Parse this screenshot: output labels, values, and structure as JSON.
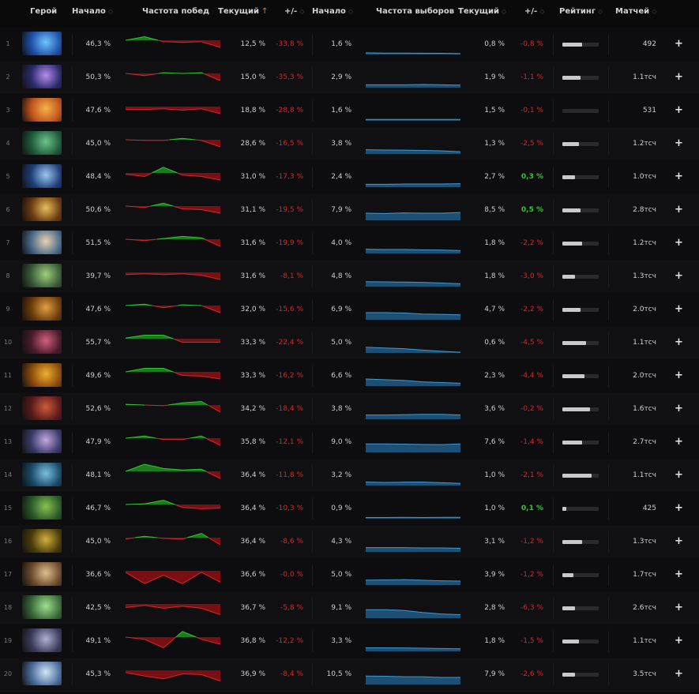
{
  "header": {
    "hero": "Герой",
    "wr_start": "Начало",
    "wr_chart": "Частота побед",
    "wr_current": "Текущий",
    "wr_diff": "+/-",
    "pr_start": "Начало",
    "pr_chart": "Частота выборов",
    "pr_current": "Текущий",
    "pr_diff": "+/-",
    "rating": "Рейтинг",
    "matches": "Матчей"
  },
  "colors": {
    "positive": "#2ec82e",
    "negative": "#d6262b",
    "win_up_fill": "#1d7a1d",
    "win_down_fill": "#7a0f13",
    "pick_line": "#3a9ad9",
    "sort_active": "#e07d2a"
  },
  "rows": [
    {
      "index": "1",
      "hero_icon": "hero-portrait",
      "wr_start": "46,3 %",
      "wr_cur": "12,5 %",
      "wr_diff": "-33,8 %",
      "wr_diff_sign": "neg",
      "pr_start": "1,6 %",
      "pr_cur": "0,8 %",
      "pr_diff": "-0,8 %",
      "pr_diff_sign": "neg",
      "rating": 0.55,
      "matches": "492",
      "wr_trend": [
        0,
        0.5,
        -0.2,
        -0.3,
        -0.2,
        -1
      ],
      "pr_trend": [
        0.12,
        0.1,
        0.1,
        0.09,
        0.08,
        0.06
      ],
      "colors": [
        "#1f4fa8",
        "#6fc3ff"
      ]
    },
    {
      "index": "2",
      "hero_icon": "hero-portrait",
      "wr_start": "50,3 %",
      "wr_cur": "15,0 %",
      "wr_diff": "-35,3 %",
      "wr_diff_sign": "neg",
      "pr_start": "2,9 %",
      "pr_cur": "1,9 %",
      "pr_diff": "-1,1 %",
      "pr_diff_sign": "neg",
      "rating": 0.5,
      "matches": "1.1тсч",
      "wr_trend": [
        0,
        -0.3,
        0.1,
        0,
        0.1,
        -1
      ],
      "pr_trend": [
        0.2,
        0.2,
        0.2,
        0.22,
        0.2,
        0.18
      ],
      "colors": [
        "#2a2a6a",
        "#b38df0"
      ]
    },
    {
      "index": "3",
      "hero_icon": "hero-portrait",
      "wr_start": "47,6 %",
      "wr_cur": "18,8 %",
      "wr_diff": "-28,8 %",
      "wr_diff_sign": "neg",
      "pr_start": "1,6 %",
      "pr_cur": "1,5 %",
      "pr_diff": "-0,1 %",
      "pr_diff_sign": "neg",
      "rating": 0,
      "matches": "531",
      "wr_trend": [
        -0.4,
        -0.4,
        -0.3,
        -0.5,
        -0.3,
        -1
      ],
      "pr_trend": [
        0.1,
        0.1,
        0.1,
        0.1,
        0.1,
        0.1
      ],
      "colors": [
        "#c0521c",
        "#f6b24a"
      ]
    },
    {
      "index": "4",
      "hero_icon": "hero-portrait",
      "wr_start": "45,0 %",
      "wr_cur": "28,6 %",
      "wr_diff": "-16,5 %",
      "wr_diff_sign": "neg",
      "pr_start": "3,8 %",
      "pr_cur": "1,3 %",
      "pr_diff": "-2,5 %",
      "pr_diff_sign": "neg",
      "rating": 0.45,
      "matches": "1.2тсч",
      "wr_trend": [
        0,
        -0.1,
        -0.1,
        0.2,
        -0.1,
        -1
      ],
      "pr_trend": [
        0.3,
        0.28,
        0.27,
        0.25,
        0.22,
        0.15
      ],
      "colors": [
        "#1d5a3a",
        "#6cc48a"
      ]
    },
    {
      "index": "5",
      "hero_icon": "hero-portrait",
      "wr_start": "48,4 %",
      "wr_cur": "31,0 %",
      "wr_diff": "-17,3 %",
      "wr_diff_sign": "neg",
      "pr_start": "2,4 %",
      "pr_cur": "2,7 %",
      "pr_diff": "0,3 %",
      "pr_diff_sign": "pos",
      "rating": 0.35,
      "matches": "1.0тсч",
      "wr_trend": [
        -0.2,
        -0.5,
        0.8,
        -0.3,
        -0.5,
        -1
      ],
      "pr_trend": [
        0.2,
        0.2,
        0.22,
        0.22,
        0.22,
        0.24
      ],
      "colors": [
        "#1f3e7a",
        "#9cc8f0"
      ]
    },
    {
      "index": "6",
      "hero_icon": "hero-portrait",
      "wr_start": "50,6 %",
      "wr_cur": "31,1 %",
      "wr_diff": "-19,5 %",
      "wr_diff_sign": "neg",
      "pr_start": "7,9 %",
      "pr_cur": "8,5 %",
      "pr_diff": "0,5 %",
      "pr_diff_sign": "pos",
      "rating": 0.5,
      "matches": "2.8тсч",
      "wr_trend": [
        0,
        -0.2,
        0.4,
        -0.4,
        -0.5,
        -1
      ],
      "pr_trend": [
        0.5,
        0.48,
        0.52,
        0.5,
        0.5,
        0.55
      ],
      "colors": [
        "#6a3a12",
        "#e8c15a"
      ]
    },
    {
      "index": "7",
      "hero_icon": "hero-portrait",
      "wr_start": "51,5 %",
      "wr_cur": "31,6 %",
      "wr_diff": "-19,9 %",
      "wr_diff_sign": "neg",
      "pr_start": "4,0 %",
      "pr_cur": "1,8 %",
      "pr_diff": "-2,2 %",
      "pr_diff_sign": "neg",
      "rating": 0.55,
      "matches": "1.2тсч",
      "wr_trend": [
        0,
        -0.2,
        0.1,
        0.4,
        0.2,
        -1
      ],
      "pr_trend": [
        0.3,
        0.28,
        0.28,
        0.26,
        0.24,
        0.2
      ],
      "colors": [
        "#4a6a8a",
        "#e8d2b0"
      ]
    },
    {
      "index": "8",
      "hero_icon": "hero-portrait",
      "wr_start": "39,7 %",
      "wr_cur": "31,6 %",
      "wr_diff": "-8,1 %",
      "wr_diff_sign": "neg",
      "pr_start": "4,8 %",
      "pr_cur": "1,8 %",
      "pr_diff": "-3,0 %",
      "pr_diff_sign": "neg",
      "rating": 0.35,
      "matches": "1.3тсч",
      "wr_trend": [
        -0.3,
        -0.2,
        -0.3,
        -0.2,
        -0.4,
        -1
      ],
      "pr_trend": [
        0.35,
        0.33,
        0.32,
        0.3,
        0.25,
        0.2
      ],
      "colors": [
        "#3a5a3a",
        "#9fd07a"
      ]
    },
    {
      "index": "9",
      "hero_icon": "hero-portrait",
      "wr_start": "47,6 %",
      "wr_cur": "32,0 %",
      "wr_diff": "-15,6 %",
      "wr_diff_sign": "neg",
      "pr_start": "6,9 %",
      "pr_cur": "4,7 %",
      "pr_diff": "-2,2 %",
      "pr_diff_sign": "neg",
      "rating": 0.5,
      "matches": "2.0тсч",
      "wr_trend": [
        0,
        0.2,
        -0.3,
        0.1,
        0,
        -1
      ],
      "pr_trend": [
        0.5,
        0.5,
        0.48,
        0.4,
        0.38,
        0.35
      ],
      "colors": [
        "#6a3a0a",
        "#e0a040"
      ]
    },
    {
      "index": "10",
      "hero_icon": "hero-portrait",
      "wr_start": "55,7 %",
      "wr_cur": "33,3 %",
      "wr_diff": "-22,4 %",
      "wr_diff_sign": "neg",
      "pr_start": "5,0 %",
      "pr_cur": "0,6 %",
      "pr_diff": "-4,5 %",
      "pr_diff_sign": "neg",
      "rating": 0.65,
      "matches": "1.1тсч",
      "wr_trend": [
        0.1,
        0.5,
        0.5,
        -0.5,
        -0.5,
        -0.5
      ],
      "pr_trend": [
        0.4,
        0.35,
        0.3,
        0.2,
        0.12,
        0.05
      ],
      "colors": [
        "#4a1a2a",
        "#d06080"
      ]
    },
    {
      "index": "11",
      "hero_icon": "hero-portrait",
      "wr_start": "49,6 %",
      "wr_cur": "33,3 %",
      "wr_diff": "-16,2 %",
      "wr_diff_sign": "neg",
      "pr_start": "6,6 %",
      "pr_cur": "2,3 %",
      "pr_diff": "-4,4 %",
      "pr_diff_sign": "neg",
      "rating": 0.6,
      "matches": "2.0тсч",
      "wr_trend": [
        0,
        0.5,
        0.5,
        -0.5,
        -0.6,
        -1
      ],
      "pr_trend": [
        0.5,
        0.45,
        0.4,
        0.3,
        0.25,
        0.2
      ],
      "colors": [
        "#8a4a0a",
        "#f0b030"
      ]
    },
    {
      "index": "12",
      "hero_icon": "hero-portrait",
      "wr_start": "52,6 %",
      "wr_cur": "34,2 %",
      "wr_diff": "-18,4 %",
      "wr_diff_sign": "neg",
      "pr_start": "3,8 %",
      "pr_cur": "3,6 %",
      "pr_diff": "-0,2 %",
      "pr_diff_sign": "neg",
      "rating": 0.75,
      "matches": "1.6тсч",
      "wr_trend": [
        0.1,
        0,
        -0.1,
        0.3,
        0.5,
        -1
      ],
      "pr_trend": [
        0.3,
        0.3,
        0.32,
        0.35,
        0.35,
        0.3
      ],
      "colors": [
        "#5a1a1a",
        "#d05a3a"
      ]
    },
    {
      "index": "13",
      "hero_icon": "hero-portrait",
      "wr_start": "47,9 %",
      "wr_cur": "35,8 %",
      "wr_diff": "-12,1 %",
      "wr_diff_sign": "neg",
      "pr_start": "9,0 %",
      "pr_cur": "7,6 %",
      "pr_diff": "-1,4 %",
      "pr_diff_sign": "neg",
      "rating": 0.55,
      "matches": "2.7тсч",
      "wr_trend": [
        0,
        0.3,
        -0.2,
        -0.2,
        0.3,
        -1
      ],
      "pr_trend": [
        0.6,
        0.6,
        0.58,
        0.56,
        0.55,
        0.6
      ],
      "colors": [
        "#3a3a6a",
        "#c0a8e0"
      ]
    },
    {
      "index": "14",
      "hero_icon": "hero-portrait",
      "wr_start": "48,1 %",
      "wr_cur": "36,4 %",
      "wr_diff": "-11,8 %",
      "wr_diff_sign": "neg",
      "pr_start": "3,2 %",
      "pr_cur": "1,0 %",
      "pr_diff": "-2,1 %",
      "pr_diff_sign": "neg",
      "rating": 0.8,
      "matches": "1.1тсч",
      "wr_trend": [
        0,
        1,
        0.4,
        0.2,
        0.3,
        -1
      ],
      "pr_trend": [
        0.25,
        0.22,
        0.24,
        0.25,
        0.2,
        0.15
      ],
      "colors": [
        "#1a4a6a",
        "#7ac0e0"
      ]
    },
    {
      "index": "15",
      "hero_icon": "hero-portrait",
      "wr_start": "46,7 %",
      "wr_cur": "36,4 %",
      "wr_diff": "-10,3 %",
      "wr_diff_sign": "neg",
      "pr_start": "0,9 %",
      "pr_cur": "1,0 %",
      "pr_diff": "0,1 %",
      "pr_diff_sign": "pos",
      "rating": 0.1,
      "matches": "425",
      "wr_trend": [
        0,
        0.1,
        0.6,
        -0.4,
        -0.6,
        -0.5
      ],
      "pr_trend": [
        0.08,
        0.08,
        0.1,
        0.08,
        0.1,
        0.1
      ],
      "colors": [
        "#2a5a2a",
        "#8ac050"
      ]
    },
    {
      "index": "16",
      "hero_icon": "hero-portrait",
      "wr_start": "45,0 %",
      "wr_cur": "36,4 %",
      "wr_diff": "-8,6 %",
      "wr_diff_sign": "neg",
      "pr_start": "4,3 %",
      "pr_cur": "3,1 %",
      "pr_diff": "-1,2 %",
      "pr_diff_sign": "neg",
      "rating": 0.55,
      "matches": "1.3тсч",
      "wr_trend": [
        -0.2,
        0.2,
        -0.1,
        -0.2,
        0.6,
        -1
      ],
      "pr_trend": [
        0.3,
        0.3,
        0.3,
        0.28,
        0.28,
        0.25
      ],
      "colors": [
        "#4a3a0a",
        "#d0b040"
      ]
    },
    {
      "index": "17",
      "hero_icon": "hero-portrait",
      "wr_start": "36,6 %",
      "wr_cur": "36,6 %",
      "wr_diff": "-0,0 %",
      "wr_diff_sign": "neg",
      "pr_start": "5,0 %",
      "pr_cur": "3,9 %",
      "pr_diff": "-1,2 %",
      "pr_diff_sign": "neg",
      "rating": 0.3,
      "matches": "1.7тсч",
      "wr_trend": [
        -0.2,
        -1.8,
        -0.6,
        -1.8,
        -0.2,
        -1.6
      ],
      "pr_trend": [
        0.35,
        0.36,
        0.38,
        0.34,
        0.3,
        0.28
      ],
      "colors": [
        "#6a4a2a",
        "#e0c090"
      ]
    },
    {
      "index": "18",
      "hero_icon": "hero-portrait",
      "wr_start": "42,5 %",
      "wr_cur": "36,7 %",
      "wr_diff": "-5,8 %",
      "wr_diff_sign": "neg",
      "pr_start": "9,1 %",
      "pr_cur": "2,8 %",
      "pr_diff": "-6,3 %",
      "pr_diff_sign": "neg",
      "rating": 0.35,
      "matches": "2.6тсч",
      "wr_trend": [
        -0.5,
        -0.2,
        -0.6,
        -0.3,
        -0.6,
        -1.5
      ],
      "pr_trend": [
        0.6,
        0.6,
        0.55,
        0.4,
        0.3,
        0.25
      ],
      "colors": [
        "#3a6a3a",
        "#a0e090"
      ]
    },
    {
      "index": "19",
      "hero_icon": "hero-portrait",
      "wr_start": "49,1 %",
      "wr_cur": "36,8 %",
      "wr_diff": "-12,2 %",
      "wr_diff_sign": "neg",
      "pr_start": "3,3 %",
      "pr_cur": "1,8 %",
      "pr_diff": "-1,5 %",
      "pr_diff_sign": "neg",
      "rating": 0.45,
      "matches": "1.1тсч",
      "wr_trend": [
        0,
        -0.3,
        -1.5,
        0.8,
        -0.3,
        -1
      ],
      "pr_trend": [
        0.25,
        0.25,
        0.24,
        0.22,
        0.2,
        0.18
      ],
      "colors": [
        "#3a3a5a",
        "#b0b0d0"
      ]
    },
    {
      "index": "20",
      "hero_icon": "hero-portrait",
      "wr_start": "45,3 %",
      "wr_cur": "36,9 %",
      "wr_diff": "-8,4 %",
      "wr_diff_sign": "neg",
      "pr_start": "10,5 %",
      "pr_cur": "7,9 %",
      "pr_diff": "-2,6 %",
      "pr_diff_sign": "neg",
      "rating": 0.35,
      "matches": "3.5тсч",
      "wr_trend": [
        -0.3,
        -0.8,
        -1.2,
        -0.5,
        -0.6,
        -1.5
      ],
      "pr_trend": [
        0.6,
        0.58,
        0.55,
        0.55,
        0.5,
        0.5
      ],
      "colors": [
        "#4a6a9a",
        "#d0e8f8"
      ]
    }
  ]
}
